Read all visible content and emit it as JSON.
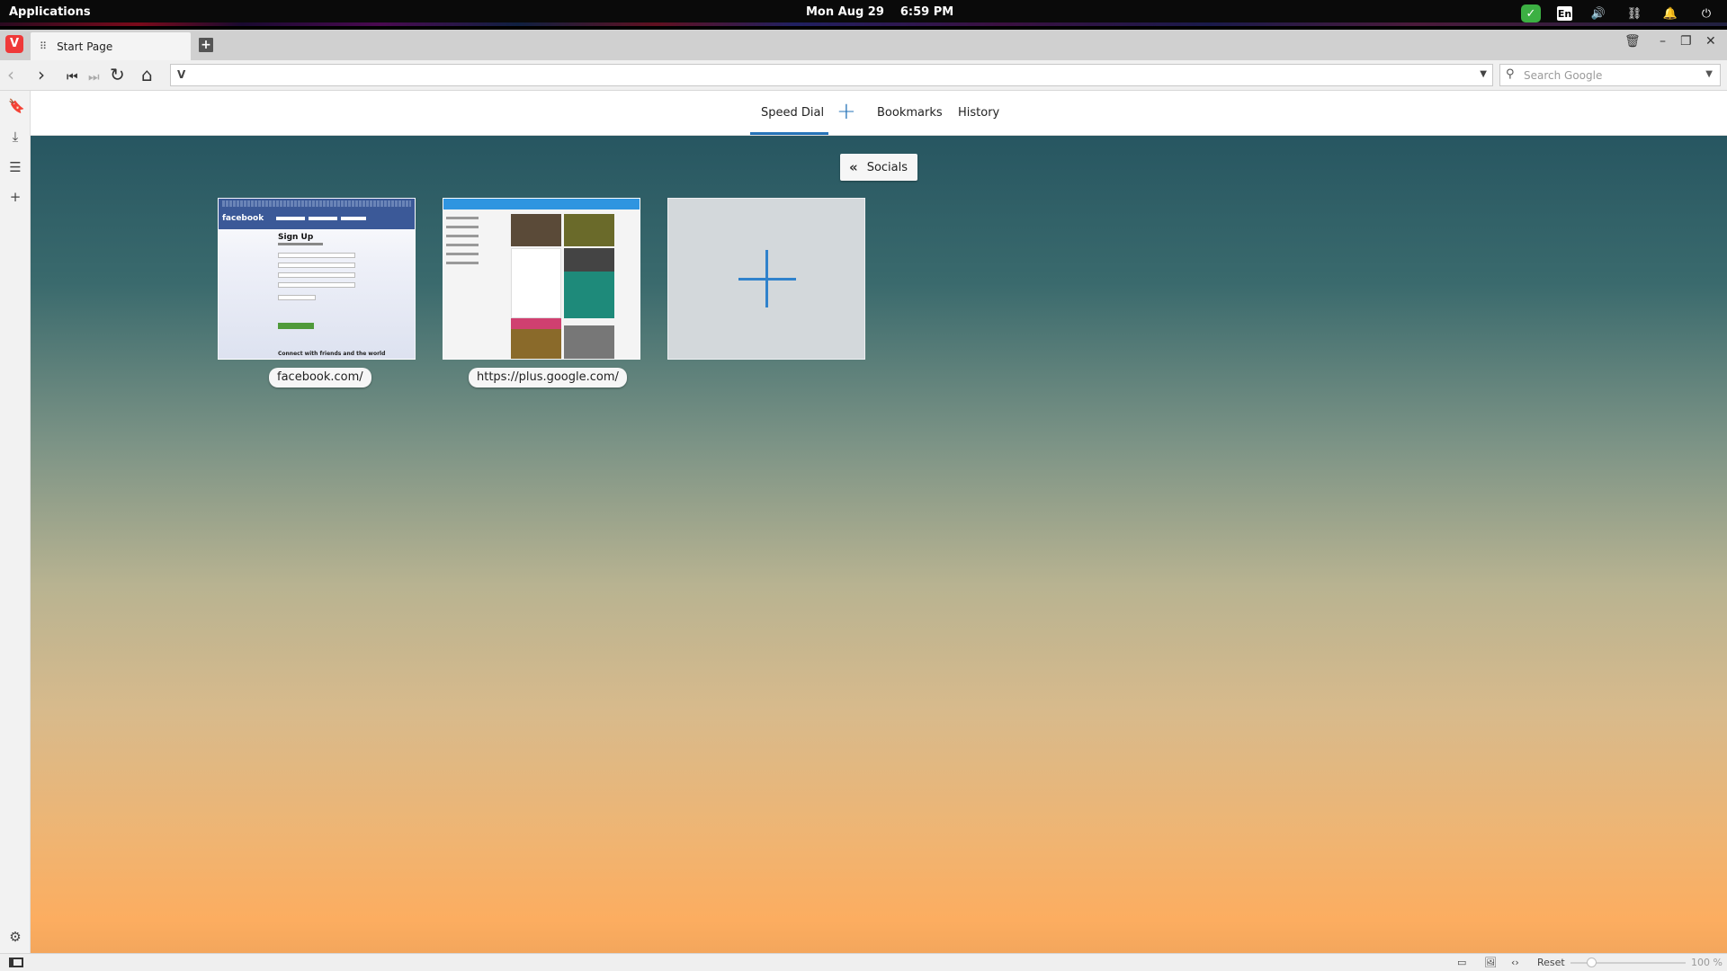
{
  "system": {
    "applications_label": "Applications",
    "date": "Mon Aug 29",
    "time": "6:59 PM",
    "keyboard_layout": "En"
  },
  "browser": {
    "tab_title": "Start Page",
    "address_value": "",
    "search_placeholder": "Search Google"
  },
  "start_page": {
    "nav": [
      "Speed Dial",
      "Bookmarks",
      "History"
    ],
    "active_nav": "Speed Dial",
    "folder_name": "Socials",
    "dials": [
      {
        "label": "facebook.com/"
      },
      {
        "label": "https://plus.google.com/"
      }
    ],
    "fb_thumb": {
      "logo": "facebook",
      "heading": "Sign Up",
      "footer": "Connect with friends and the world"
    }
  },
  "statusbar": {
    "reset_label": "Reset",
    "zoom": "100 %"
  },
  "colors": {
    "accent": "#2673b8",
    "vivaldi_red": "#ef3939",
    "facebook_blue": "#3b5998"
  }
}
